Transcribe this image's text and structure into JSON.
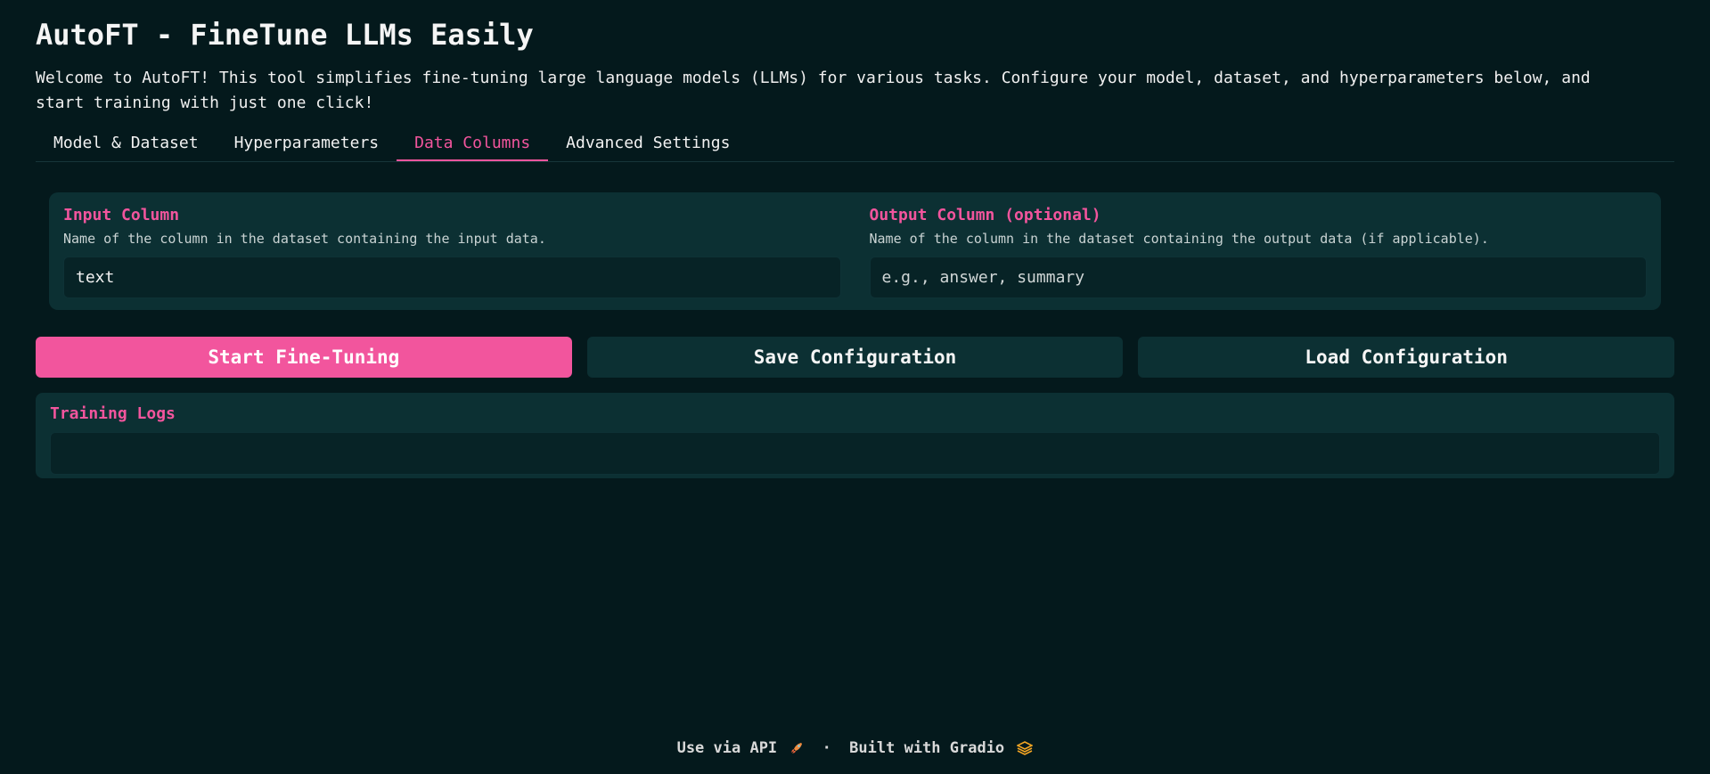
{
  "app": {
    "title": "AutoFT - FineTune LLMs Easily",
    "intro": "Welcome to AutoFT! This tool simplifies fine-tuning large language models (LLMs) for various tasks. Configure your model, dataset, and hyperparameters below, and start training with just one click!"
  },
  "tabs": [
    {
      "label": "Model & Dataset",
      "active": false
    },
    {
      "label": "Hyperparameters",
      "active": false
    },
    {
      "label": "Data Columns",
      "active": true
    },
    {
      "label": "Advanced Settings",
      "active": false
    }
  ],
  "data_columns": {
    "input_column": {
      "label": "Input Column",
      "info": "Name of the column in the dataset containing the input data.",
      "value": "text",
      "placeholder": ""
    },
    "output_column": {
      "label": "Output Column (optional)",
      "info": "Name of the column in the dataset containing the output data (if applicable).",
      "value": "",
      "placeholder": "e.g., answer, summary"
    }
  },
  "actions": {
    "start": "Start Fine-Tuning",
    "save": "Save Configuration",
    "load": "Load Configuration"
  },
  "logs": {
    "label": "Training Logs",
    "value": ""
  },
  "footer": {
    "api_link": "Use via API",
    "separator": "·",
    "built_with": "Built with Gradio",
    "api_icon": "rocket-icon",
    "gradio_icon": "gradio-logo-icon"
  },
  "colors": {
    "background": "#04191c",
    "panel": "#0c3033",
    "accent": "#f2559d"
  }
}
